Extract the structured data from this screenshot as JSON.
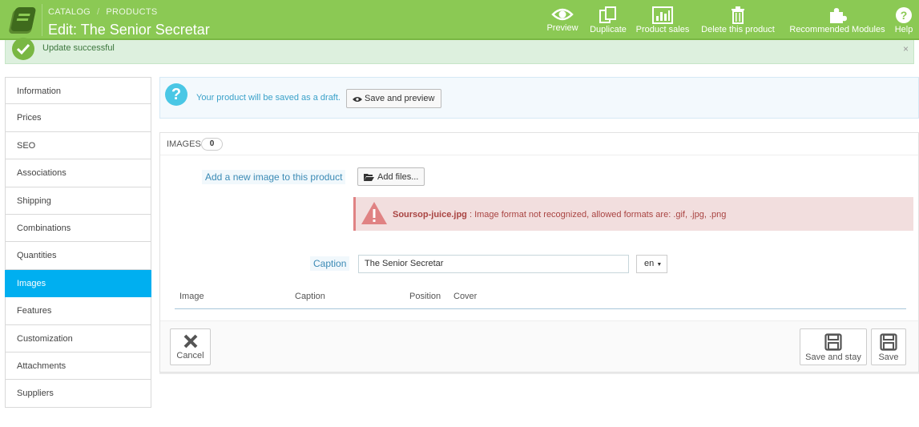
{
  "header": {
    "breadcrumb": [
      "CATALOG",
      "PRODUCTS"
    ],
    "title": "Edit: The Senior Secretar",
    "toolbar": [
      {
        "label": "Preview",
        "icon": "eye-icon"
      },
      {
        "label": "Duplicate",
        "icon": "copy-icon"
      },
      {
        "label": "Product sales",
        "icon": "bar-chart-icon"
      },
      {
        "label": "Delete this product",
        "icon": "trash-icon"
      },
      {
        "label": "Recommended Modules",
        "icon": "puzzle-icon"
      },
      {
        "label": "Help",
        "icon": "question-icon"
      }
    ]
  },
  "alert": {
    "message": "Update successful",
    "close": "×"
  },
  "sidebar": {
    "items": [
      {
        "label": "Information"
      },
      {
        "label": "Prices"
      },
      {
        "label": "SEO"
      },
      {
        "label": "Associations"
      },
      {
        "label": "Shipping"
      },
      {
        "label": "Combinations"
      },
      {
        "label": "Quantities"
      },
      {
        "label": "Images",
        "active": true
      },
      {
        "label": "Features"
      },
      {
        "label": "Customization"
      },
      {
        "label": "Attachments"
      },
      {
        "label": "Suppliers"
      }
    ]
  },
  "draft": {
    "message": "Your product will be saved as a draft.",
    "button": "Save and preview",
    "icon": "question-icon"
  },
  "images_panel": {
    "title": "IMAGES",
    "count": "0",
    "add_label": "Add a new image to this product",
    "add_button": "Add files...",
    "error": {
      "filename": "Soursop-juice.jpg",
      "message": " : Image format not recognized, allowed formats are: .gif, .jpg, .png"
    },
    "caption_label": "Caption",
    "caption_value": "The Senior Secretar",
    "language": "en",
    "columns": [
      "Image",
      "Caption",
      "Position",
      "Cover"
    ],
    "cancel": "Cancel",
    "save_and_stay": "Save and stay",
    "save": "Save"
  },
  "colors": {
    "header": "#8bc954",
    "active": "#00aff0",
    "error_bg": "#f2dede",
    "error_text": "#a94442",
    "info_text": "#3aa1c9"
  }
}
